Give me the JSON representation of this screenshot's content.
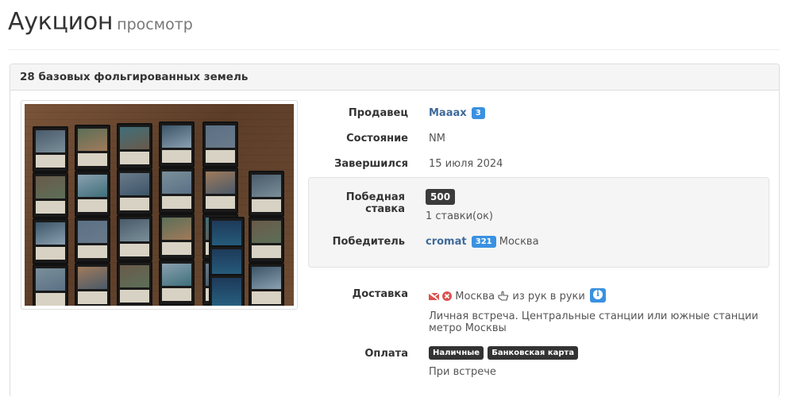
{
  "header": {
    "title": "Аукцион",
    "subtitle": "просмотр"
  },
  "lot": {
    "title": "28 базовых фольгированных земель",
    "seller": {
      "label": "Продавец",
      "name": "Maaax",
      "rating": "3"
    },
    "condition": {
      "label": "Состояние",
      "value": "NM"
    },
    "ended": {
      "label": "Завершился",
      "value": "15 июля 2024"
    },
    "winning_bid": {
      "label": "Победная ставка",
      "amount": "500",
      "bids_count": "1 ставки(ок)"
    },
    "winner": {
      "label": "Победитель",
      "name": "cromat",
      "rating": "321",
      "city": "Москва"
    },
    "delivery": {
      "label": "Доставка",
      "city": "Москва",
      "method": "из рук в руки",
      "note": "Личная встреча. Центральные станции или южные станции метро Москвы",
      "icons": [
        "mail-crossed-icon",
        "delete-circle-icon",
        "hand-pointer-icon",
        "info-icon"
      ]
    },
    "payment": {
      "label": "Оплата",
      "methods": [
        "Наличные",
        "Банковская карта"
      ],
      "note": "При встрече"
    }
  },
  "colors": {
    "link": "#3f6a9a",
    "badge_blue": "#3a91e0",
    "badge_dark": "#333333",
    "red_icon": "#d9534f"
  }
}
